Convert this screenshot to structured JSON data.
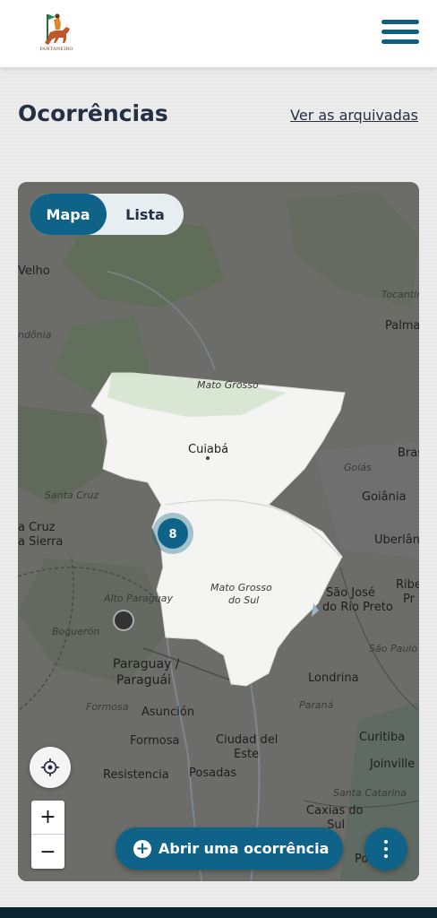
{
  "header": {
    "logo_text": "PANTANEIRO",
    "menu_icon": "hamburger-icon"
  },
  "page": {
    "title": "Ocorrências",
    "archived_link": "Ver as arquivadas"
  },
  "view_toggle": {
    "map_label": "Mapa",
    "list_label": "Lista",
    "active": "Mapa"
  },
  "map": {
    "cluster_count": "8",
    "labels": {
      "velho": "Velho",
      "rondonia": "ndônia",
      "tocantins": "Tocantin",
      "palmas": "Palma",
      "mato_grosso_state": "Mato Grosso",
      "cuiaba": "Cuiabá",
      "brasilia": "Bras",
      "goias": "Goiás",
      "goiania": "Goiânia",
      "santa_cruz_dept": "Santa Cruz",
      "santa_cruz_city": "a Cruz",
      "sierra": "a Sierra",
      "uberlandia": "Uberlân",
      "ribeirao": "Ribe",
      "ribeirao2": "Pr",
      "ms_state_1": "Mato Grosso",
      "ms_state_2": "do Sul",
      "sjrp_1": "São José",
      "sjrp_2": "do Rio Preto",
      "alto_paraguay": "Alto Paraguay",
      "boqueron": "Boquerón",
      "paraguay_1": "Paraguay /",
      "paraguay_2": "Paraguái",
      "sao_paulo": "São Paulo",
      "londrina": "Londrina",
      "formosa_it": "Formosa",
      "parana": "Paraná",
      "asuncion": "Asunción",
      "curitiba": "Curitiba",
      "formosa": "Formosa",
      "ciudad_1": "Ciudad del",
      "ciudad_2": "Este",
      "joinville": "Joinville",
      "resistencia": "Resistencia",
      "posadas": "Posadas",
      "santa_catarina": "Santa Catarina",
      "caxias_1": "Caxias do",
      "caxias_2": "Sul",
      "porto": "Porto"
    }
  },
  "controls": {
    "locate_icon": "crosshair-icon",
    "zoom_in": "+",
    "zoom_out": "−",
    "open_button_label": "Abrir uma ocorrência",
    "open_button_icon": "plus-circle-icon",
    "more_icon": "more-vertical-icon"
  },
  "colors": {
    "primary": "#0f6388",
    "title": "#253044",
    "highlight_region": "#f4f4f2",
    "map_dim": "#6b6b69"
  }
}
